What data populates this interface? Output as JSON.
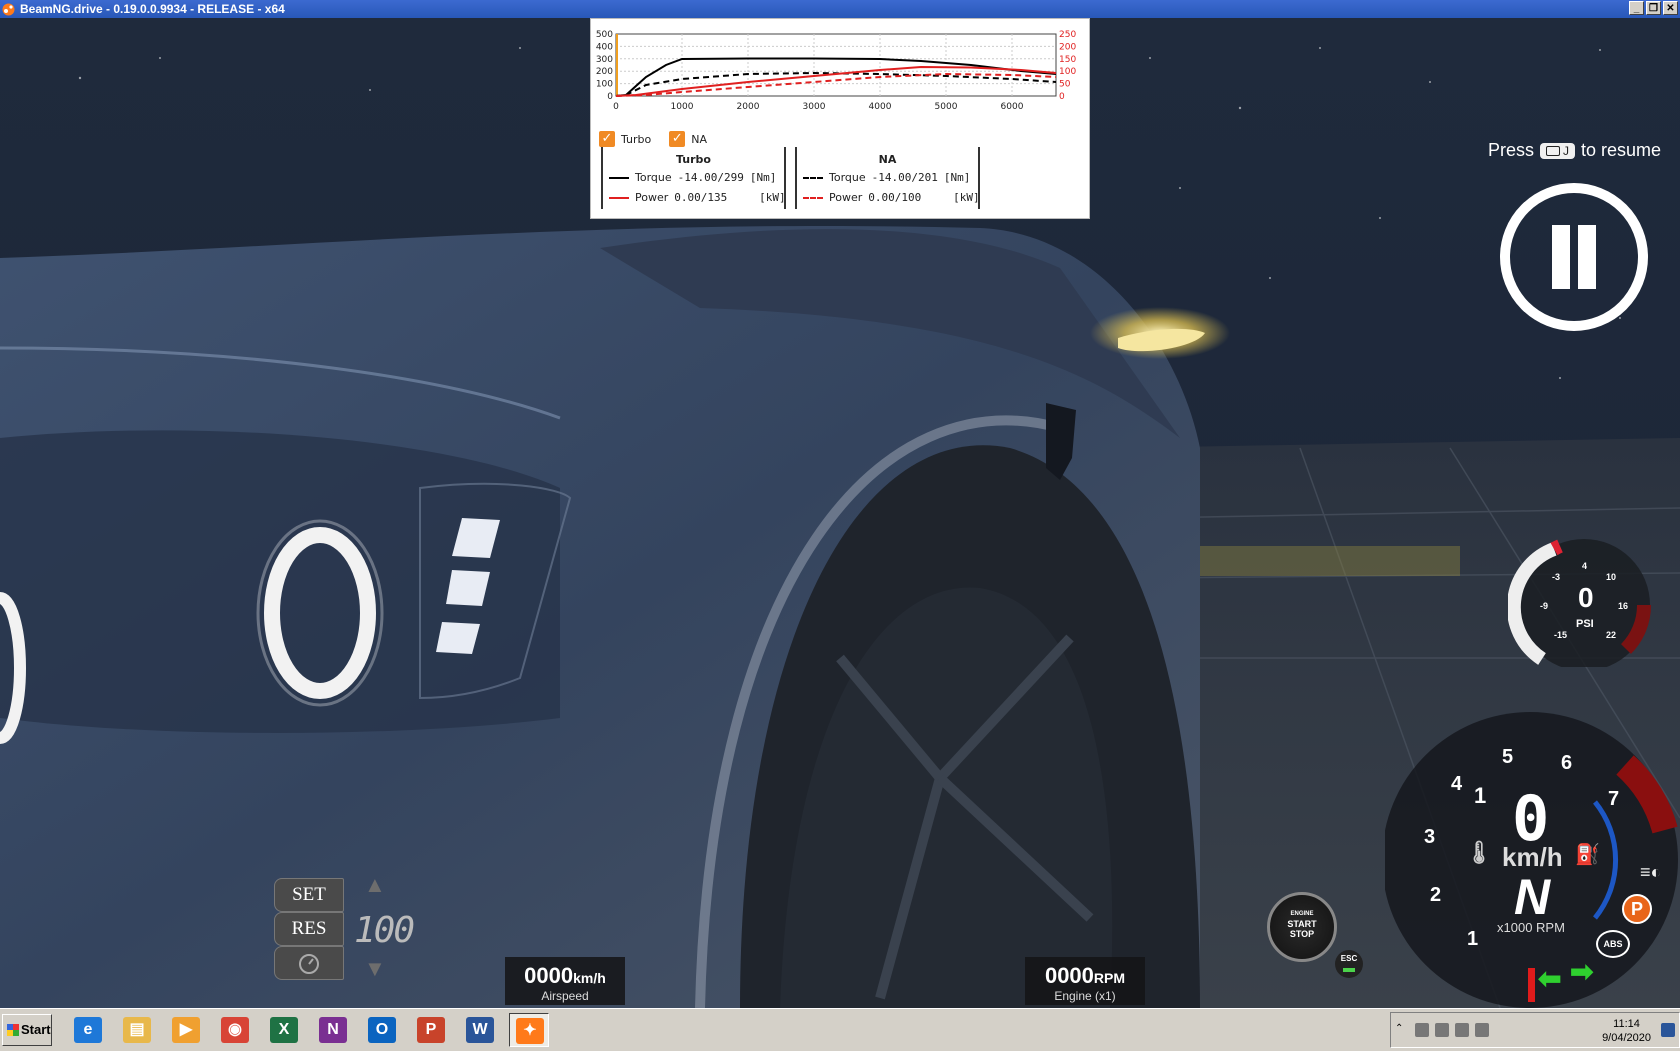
{
  "window": {
    "title": "BeamNG.drive - 0.19.0.0.9934 - RELEASE - x64",
    "min": "_",
    "max": "❐",
    "close": "✕"
  },
  "graph": {
    "y_left_ticks": [
      "500",
      "400",
      "300",
      "200",
      "100",
      "0"
    ],
    "y_right_ticks": [
      "250",
      "200",
      "150",
      "100",
      "50",
      "0"
    ],
    "x_ticks": [
      "0",
      "1000",
      "2000",
      "3000",
      "4000",
      "5000",
      "6000"
    ],
    "checks": [
      {
        "label": "Turbo",
        "checked": true
      },
      {
        "label": "NA",
        "checked": true
      }
    ],
    "turbo": {
      "header": "Turbo",
      "torque_label": "Torque",
      "torque_value": "-14.00/299",
      "torque_unit": "[Nm]",
      "power_label": "Power",
      "power_value": "0.00/135",
      "power_unit": "[kW]"
    },
    "na": {
      "header": "NA",
      "torque_label": "Torque",
      "torque_value": "-14.00/201",
      "torque_unit": "[Nm]",
      "power_label": "Power",
      "power_value": "0.00/100",
      "power_unit": "[kW]"
    },
    "colors": {
      "torque": "#000000",
      "power": "#e02020"
    }
  },
  "pause": {
    "press": "Press",
    "key": "J",
    "resume": "to resume"
  },
  "cruise": {
    "set": "SET",
    "res": "RES",
    "speed": "100"
  },
  "airspeed": {
    "value": "0000",
    "unit": "km/h",
    "label": "Airspeed"
  },
  "engine_rpm": {
    "value": "0000",
    "unit": "RPM",
    "label": "Engine (x1)"
  },
  "engine_button": {
    "top": "ENGINE",
    "line1": "START",
    "line2": "STOP"
  },
  "esc": {
    "label": "ESC"
  },
  "boost_gauge": {
    "value": "0",
    "unit": "PSI",
    "ticks": [
      "-15",
      "-9",
      "-3",
      "4",
      "10",
      "16",
      "22"
    ]
  },
  "main_gauge": {
    "speed": "0",
    "speed_unit": "km/h",
    "gear": "N",
    "rpm_label": "x1000 RPM",
    "ticks": [
      "1",
      "2",
      "3",
      "4",
      "5",
      "6",
      "7"
    ],
    "parking": "P",
    "abs": "ABS"
  },
  "taskbar": {
    "start": "Start",
    "apps": [
      {
        "name": "internet-explorer",
        "glyph": "e",
        "color": "#1e78d8"
      },
      {
        "name": "file-explorer",
        "glyph": "▤",
        "color": "#e8b84a"
      },
      {
        "name": "media-player",
        "glyph": "▶",
        "color": "#f0a030"
      },
      {
        "name": "chrome",
        "glyph": "◉",
        "color": "#d84436"
      },
      {
        "name": "excel",
        "glyph": "X",
        "color": "#1f7244"
      },
      {
        "name": "onenote",
        "glyph": "N",
        "color": "#7a2f92"
      },
      {
        "name": "outlook",
        "glyph": "O",
        "color": "#0a64c0"
      },
      {
        "name": "powerpoint",
        "glyph": "P",
        "color": "#c8432a"
      },
      {
        "name": "word",
        "glyph": "W",
        "color": "#2a5599"
      },
      {
        "name": "beamng",
        "glyph": "✦",
        "color": "#ff7a1a"
      }
    ],
    "time": "11:14",
    "date": "9/04/2020"
  }
}
